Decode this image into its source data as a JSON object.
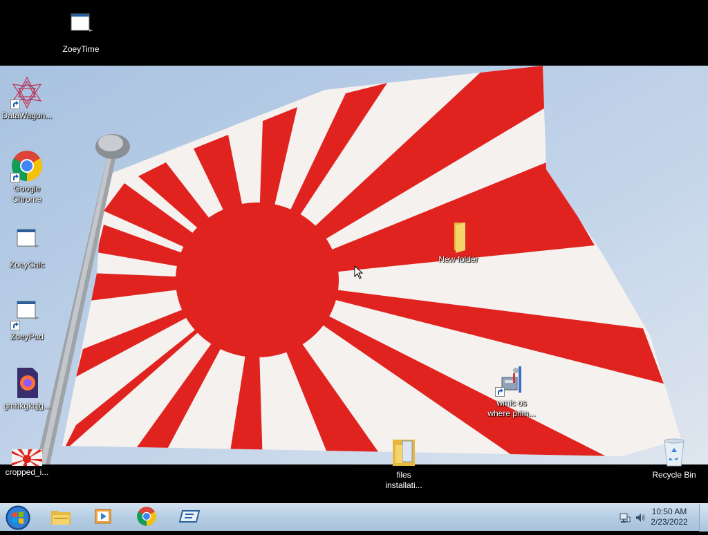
{
  "desktop": {
    "icons": [
      {
        "id": "zoeytime",
        "label": "ZoeyTime",
        "icon": "app-window-icon",
        "shortcut": false
      },
      {
        "id": "datawagon",
        "label": "DataWagon...",
        "icon": "datawagon-icon",
        "shortcut": true
      },
      {
        "id": "chrome",
        "label": "Google Chrome",
        "icon": "chrome-icon",
        "shortcut": true
      },
      {
        "id": "zoeycalc",
        "label": "ZoeyCalc",
        "icon": "app-window-icon",
        "shortcut": false
      },
      {
        "id": "zoeypad",
        "label": "ZoeyPad",
        "icon": "app-window-icon",
        "shortcut": true
      },
      {
        "id": "gmhkg",
        "label": "gmhkgkqjg...",
        "icon": "firefox-file-icon",
        "shortcut": false
      },
      {
        "id": "cropped",
        "label": "cropped_i...",
        "icon": "image-thumbnail-icon",
        "shortcut": false
      },
      {
        "id": "newfolder",
        "label": "New folder",
        "icon": "folder-icon",
        "shortcut": false
      },
      {
        "id": "wmic",
        "label": "wmic os where prim...",
        "icon": "tools-icon",
        "shortcut": true
      },
      {
        "id": "files",
        "label": "files installati...",
        "icon": "folder-files-icon",
        "shortcut": false
      },
      {
        "id": "recycle",
        "label": "Recycle Bin",
        "icon": "recycle-bin-icon",
        "shortcut": false
      }
    ]
  },
  "taskbar": {
    "pinned": [
      {
        "name": "explorer",
        "icon": "file-explorer-icon"
      },
      {
        "name": "media-player",
        "icon": "media-player-icon"
      },
      {
        "name": "chrome",
        "icon": "chrome-icon"
      },
      {
        "name": "app",
        "icon": "app-icon"
      }
    ],
    "clock": {
      "time": "10:50 AM",
      "date": "2/23/2022"
    }
  },
  "colors": {
    "flag_red": "#e0231f",
    "flag_white": "#f4f1ee",
    "sky": "#b9cde4",
    "taskbar": "#b5cde3"
  }
}
